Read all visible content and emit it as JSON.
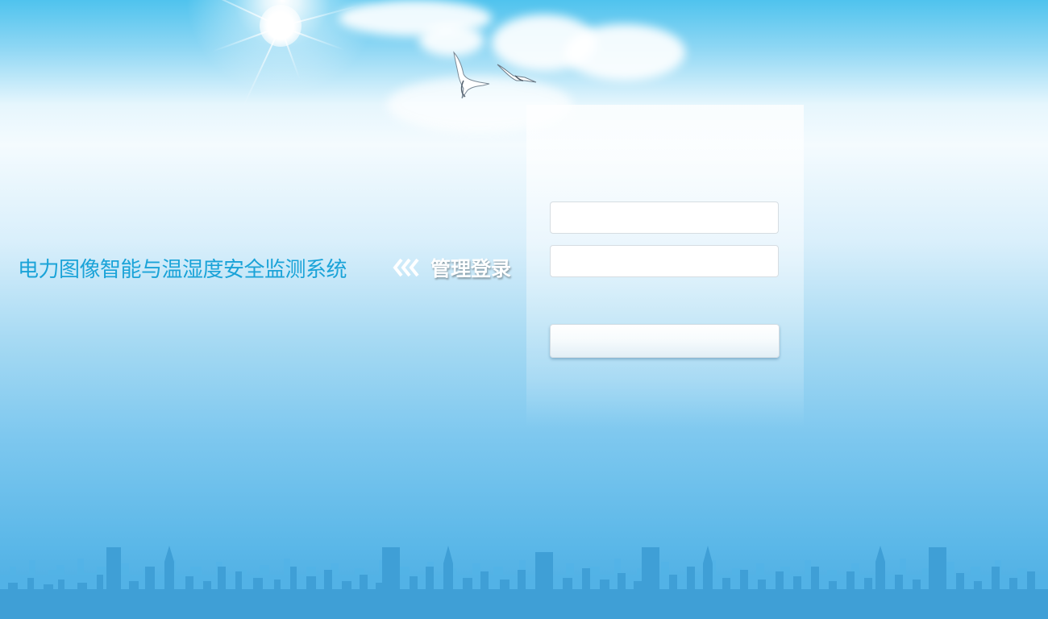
{
  "header": {
    "system_title": "电力图像智能与温湿度安全监测系统",
    "login_label": "管理登录"
  },
  "login_form": {
    "username_value": "",
    "password_value": "",
    "submit_label": ""
  },
  "icons": {
    "title_arrows": "chevrons-left-icon",
    "sun": "sun-icon",
    "birds": "seagulls-icon",
    "skyline": "city-skyline-icon"
  },
  "colors": {
    "title_text": "#1aa3d8",
    "sky_top": "#4fc3ee",
    "sky_bottom": "#4aa9e0",
    "skyline": "#3f9fd6"
  }
}
